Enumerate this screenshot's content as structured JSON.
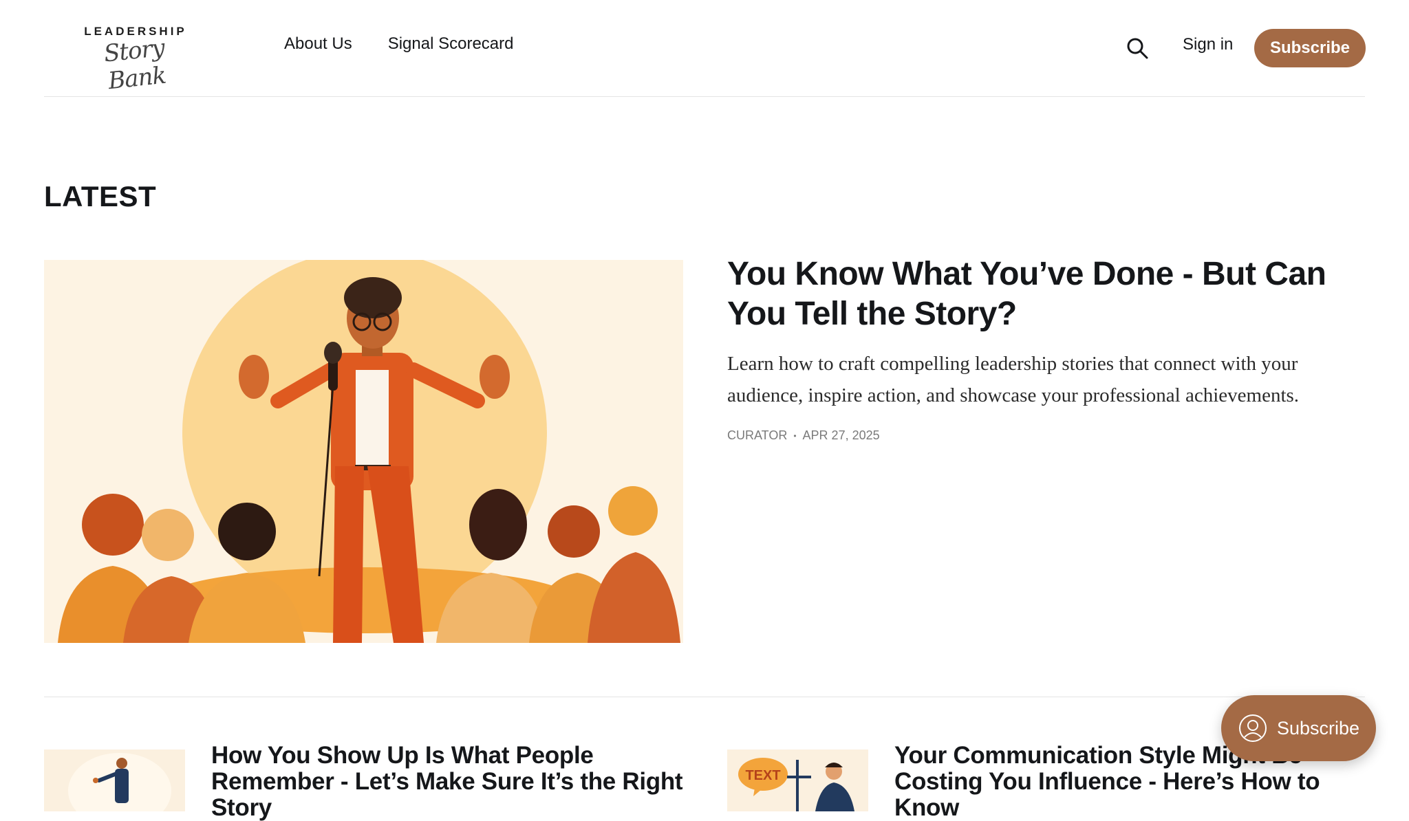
{
  "header": {
    "logo_top": "LEADERSHIP",
    "logo_script": "Story Bank",
    "nav": [
      "About Us",
      "Signal Scorecard"
    ],
    "search_icon": "search-icon",
    "signin_label": "Sign in",
    "subscribe_label": "Subscribe"
  },
  "latest": {
    "heading": "LATEST",
    "feature": {
      "title": "You Know What You’ve Done - But Can You Tell the Story?",
      "excerpt": "Learn how to craft compelling leadership stories that connect with your audience, inspire action, and showcase your professional achievements.",
      "author": "CURATOR",
      "separator": "•",
      "date": "APR 27, 2025",
      "image_icon": "speaker-illustration"
    }
  },
  "cards": [
    {
      "title": "How You Show Up Is What People Remember - Let’s Make Sure It’s the Right Story",
      "image_icon": "presenter-illustration"
    },
    {
      "title": "Your Communication Style Might Be Costing You Influence - Here’s How to Know",
      "image_icon": "thinking-man-illustration",
      "image_text": "TEXT"
    }
  ],
  "floating": {
    "label": "Subscribe",
    "icon": "user-circle-icon"
  },
  "colors": {
    "accent": "#a46a45",
    "text": "#15171a",
    "muted": "#7a7a7a",
    "divider": "#e4e4e4"
  }
}
